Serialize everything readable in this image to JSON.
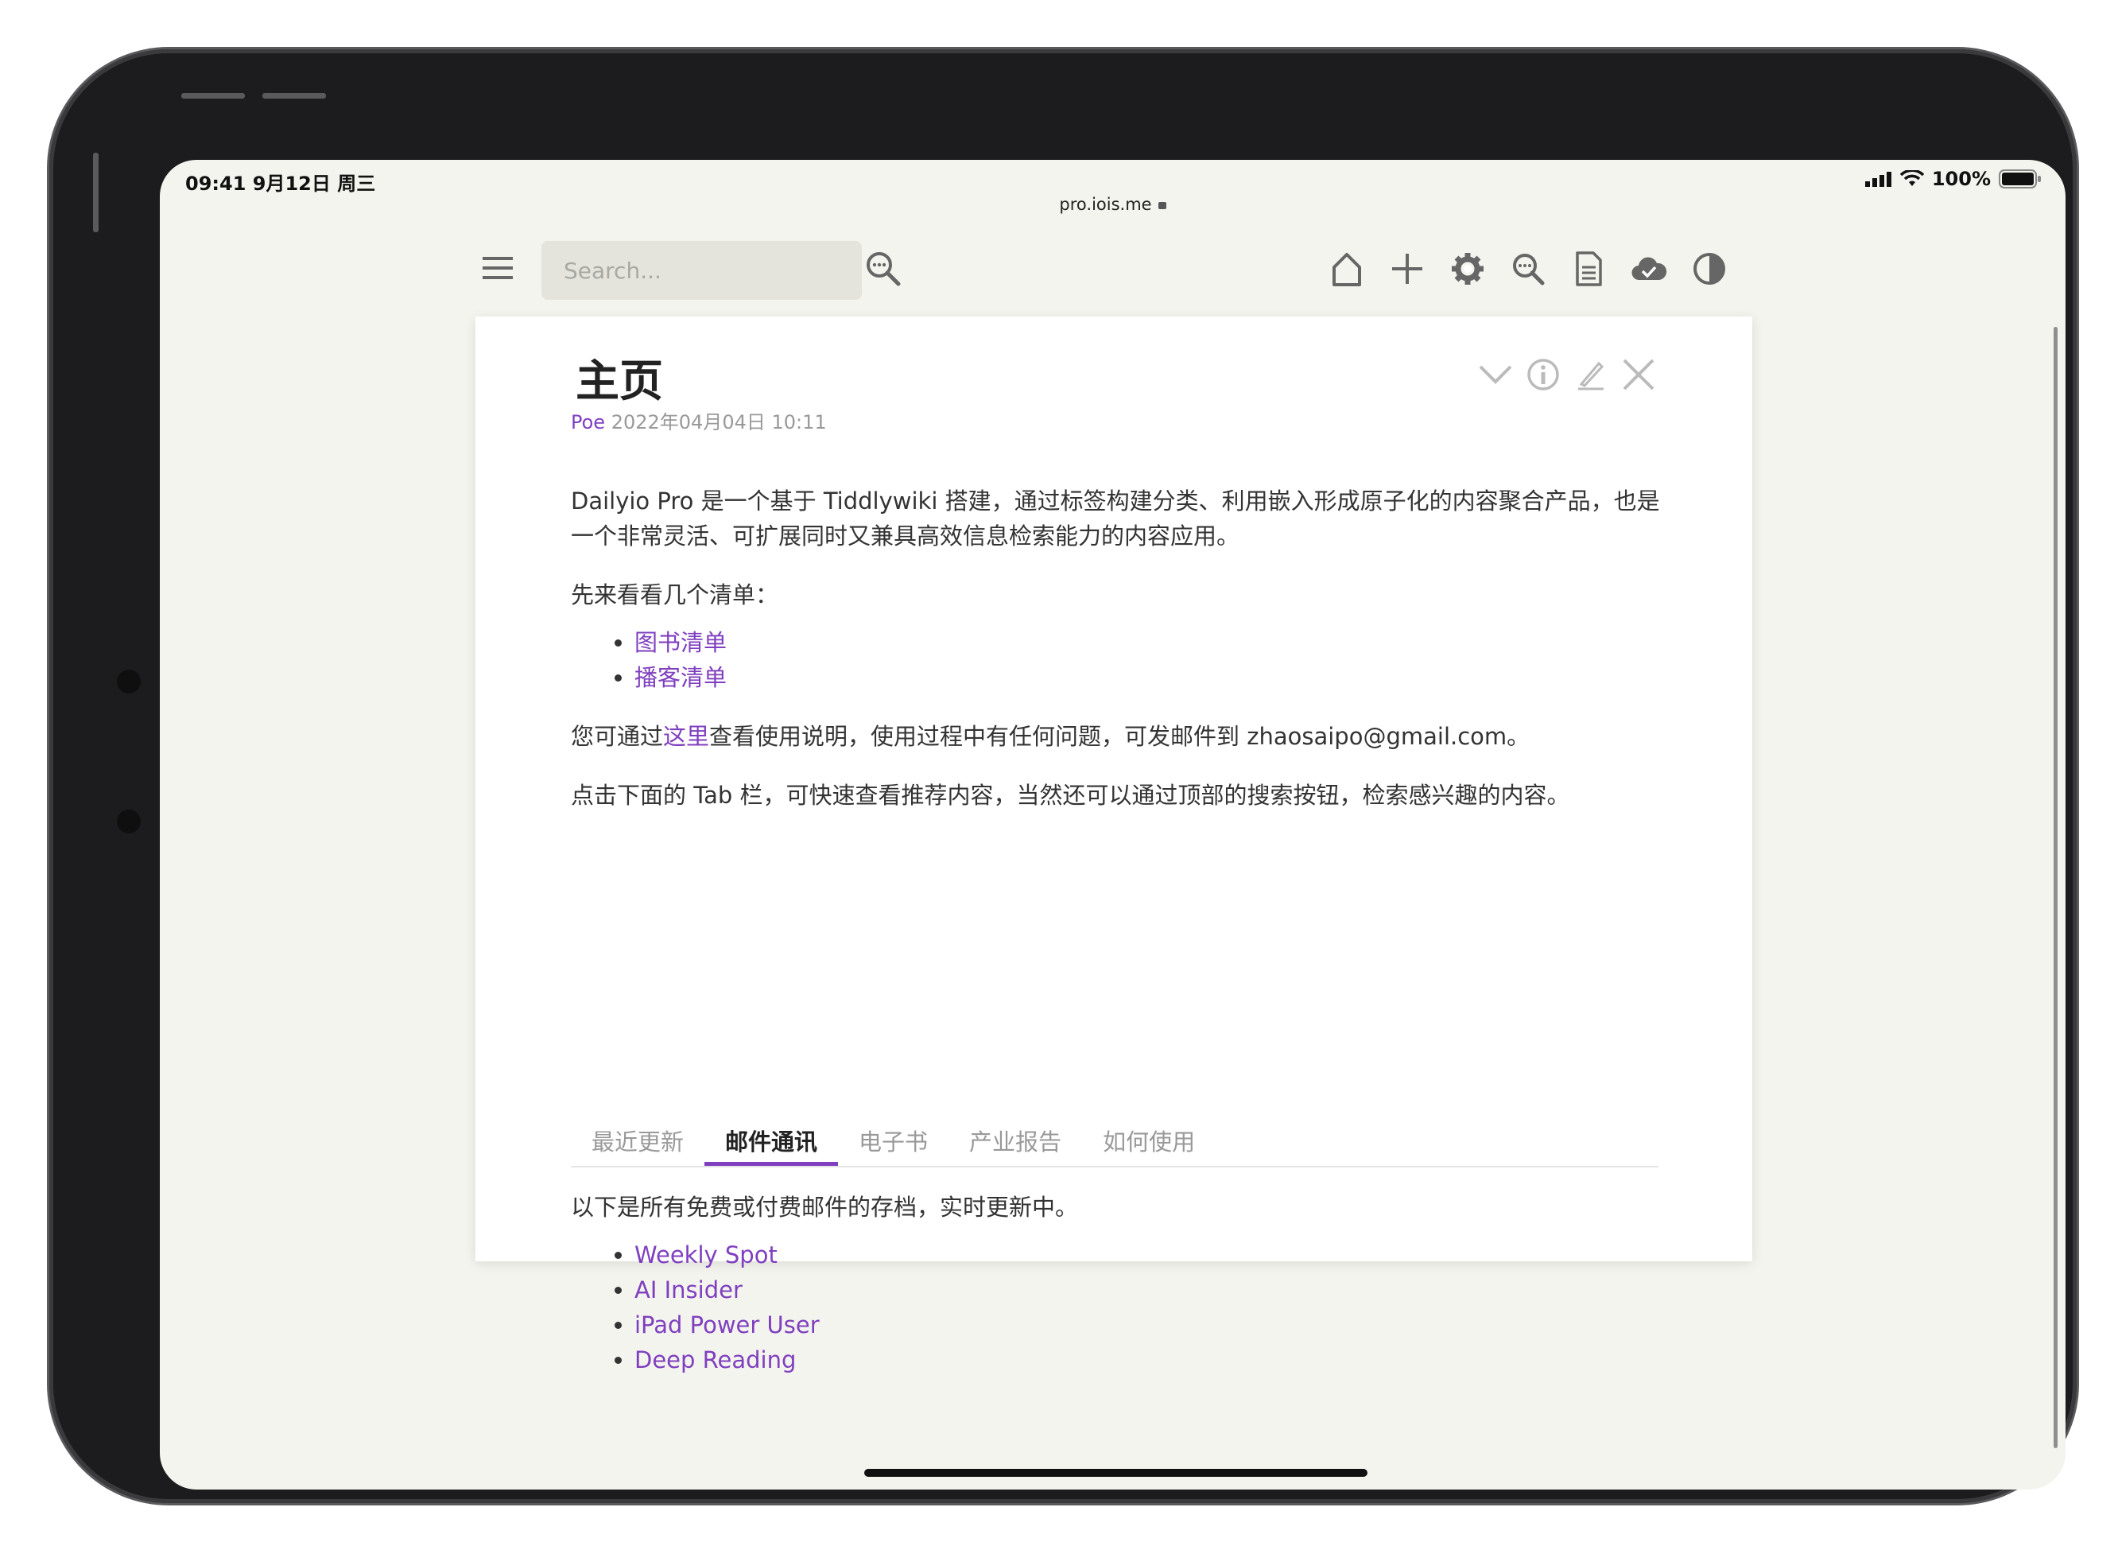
{
  "status": {
    "time": "09:41  9月12日 周三",
    "battery": "100%"
  },
  "browser": {
    "url": "pro.iois.me"
  },
  "toolbar": {
    "search_placeholder": "Search...",
    "icons": [
      "home-icon",
      "plus-icon",
      "gear-icon",
      "magnifier-icon",
      "document-icon",
      "cloud-check-icon",
      "contrast-icon"
    ]
  },
  "tiddler": {
    "title": "主页",
    "author": "Poe",
    "date": " 2022年04月04日 10:11",
    "intro": "Dailyio Pro 是一个基于 Tiddlywiki 搭建，通过标签构建分类、利用嵌入形成原子化的内容聚合产品，也是一个非常灵活、可扩展同时又兼具高效信息检索能力的内容应用。",
    "lists_heading": "先来看看几个清单：",
    "lists": [
      "图书清单",
      "播客清单"
    ],
    "help_pre": "您可通过",
    "help_link": "这里",
    "help_post": "查看使用说明，使用过程中有任何问题，可发邮件到 zhaosaipo@gmail.com。",
    "tab_hint": "点击下面的 Tab 栏，可快速查看推荐内容，当然还可以通过顶部的搜索按钮，检索感兴趣的内容。"
  },
  "tabs": [
    {
      "label": "最近更新"
    },
    {
      "label": "邮件通讯",
      "active": true
    },
    {
      "label": "电子书"
    },
    {
      "label": "产业报告"
    },
    {
      "label": "如何使用"
    }
  ],
  "tab_content": {
    "intro": "以下是所有免费或付费邮件的存档，实时更新中。",
    "items": [
      "Weekly Spot",
      "AI Insider",
      "iPad Power User",
      "Deep Reading"
    ]
  },
  "colors": {
    "accent": "#7f3fbf",
    "background": "#f4f4ee"
  }
}
